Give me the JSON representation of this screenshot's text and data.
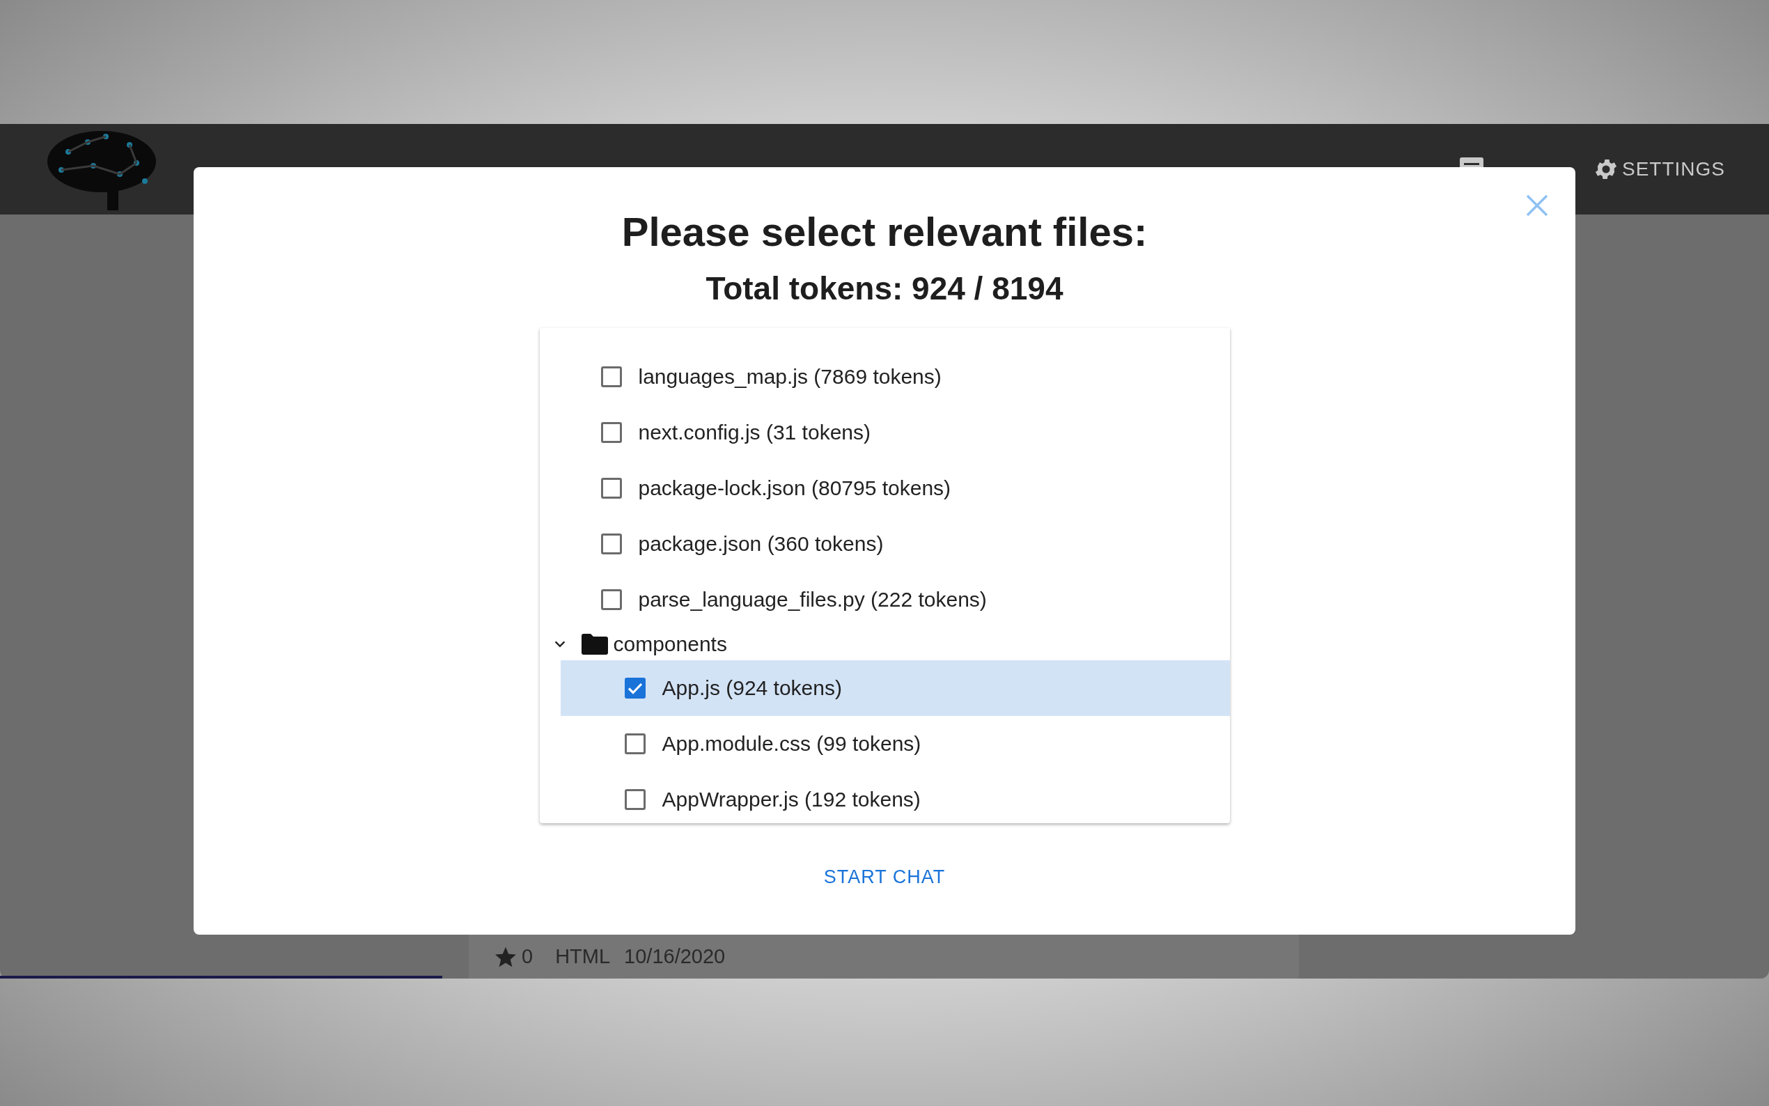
{
  "header": {
    "settings_label": "SETTINGS"
  },
  "dialog": {
    "title": "Please select relevant files:",
    "total_tokens": "Total tokens: 924 / 8194",
    "files": [
      {
        "kind": "file",
        "label": "languages_map.js (7869 tokens)",
        "checked": false,
        "selected": false
      },
      {
        "kind": "file",
        "label": "next.config.js (31 tokens)",
        "checked": false,
        "selected": false
      },
      {
        "kind": "file",
        "label": "package-lock.json (80795 tokens)",
        "checked": false,
        "selected": false
      },
      {
        "kind": "file",
        "label": "package.json (360 tokens)",
        "checked": false,
        "selected": false
      },
      {
        "kind": "file",
        "label": "parse_language_files.py (222 tokens)",
        "checked": false,
        "selected": false
      },
      {
        "kind": "folder",
        "label": "components",
        "expanded": true,
        "children": [
          {
            "kind": "file",
            "label": "App.js (924 tokens)",
            "checked": true,
            "selected": true
          },
          {
            "kind": "file",
            "label": "App.module.css (99 tokens)",
            "checked": false,
            "selected": false
          },
          {
            "kind": "file",
            "label": "AppWrapper.js (192 tokens)",
            "checked": false,
            "selected": false
          }
        ]
      }
    ],
    "action": "START CHAT"
  },
  "background_row": {
    "star_count": "0",
    "language": "HTML",
    "date": "10/16/2020"
  }
}
